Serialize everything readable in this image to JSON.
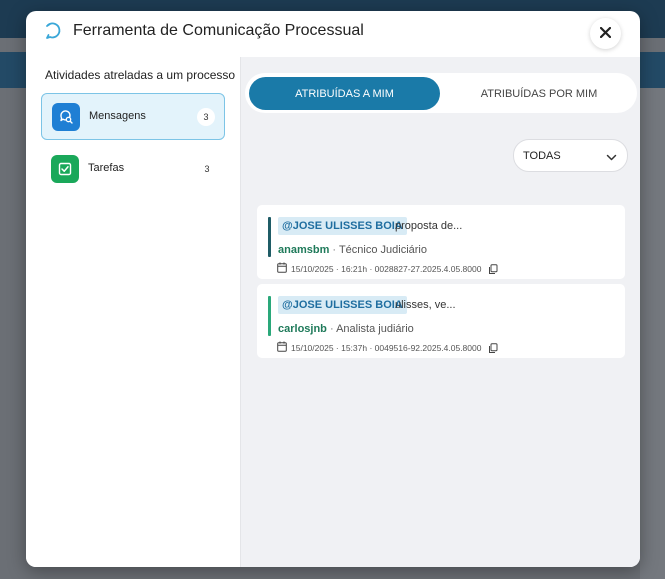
{
  "modal": {
    "title": "Ferramenta de Comunicação Processual"
  },
  "sidebar": {
    "title": "Atividades atreladas a um processo",
    "items": [
      {
        "label": "Mensagens",
        "count": "3",
        "icon": "message-search-icon",
        "color": "#1f7fd4",
        "active": true
      },
      {
        "label": "Tarefas",
        "count": "3",
        "icon": "task-check-icon",
        "color": "#1aa85a",
        "active": false
      }
    ]
  },
  "tabs": [
    {
      "label": "ATRIBUÍDAS A MIM",
      "active": true
    },
    {
      "label": "ATRIBUÍDAS POR MIM",
      "active": false
    }
  ],
  "filter": {
    "value": "TODAS"
  },
  "messages": [
    {
      "mention": "@JOSE ULISSES BOIA",
      "snippet": "proposta de...",
      "author": "anamsbm",
      "separator": "·",
      "role": "Técnico Judiciário",
      "meta": "15/10/2025 · 16:21h · 0028827-27.2025.4.05.8000",
      "bar_color": "#1f5c66"
    },
    {
      "mention": "@JOSE ULISSES BOIA",
      "snippet": "ulisses, ve...",
      "author": "carlosjnb",
      "separator": "·",
      "role": "Analista judiário",
      "meta": "15/10/2025 · 15:37h · 0049516-92.2025.4.05.8000",
      "bar_color": "#2aa87a"
    }
  ],
  "colors": {
    "accent": "#1a7aa8",
    "mention_bg": "#d8ebf5",
    "author_green": "#1f7a5a"
  }
}
